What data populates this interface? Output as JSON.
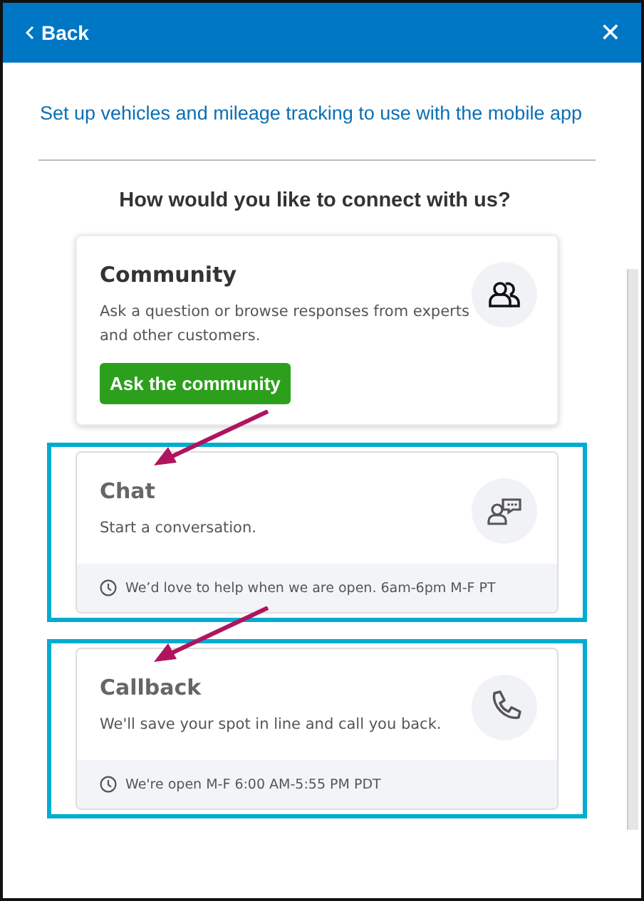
{
  "header": {
    "back_label": "Back",
    "close_label": "✕"
  },
  "link": "Set up vehicles and mileage tracking to use with the mobile app",
  "heading": "How would you like to connect with us?",
  "cards": [
    {
      "kind": "community",
      "title": "Community",
      "description": "Ask a question or browse responses from experts and other customers.",
      "button": "Ask the community",
      "highlighted": false
    },
    {
      "kind": "chat",
      "title": "Chat",
      "description": "Start a conversation.",
      "hours": "We’d love to help when we are open. 6am-6pm M-F PT",
      "highlighted": true
    },
    {
      "kind": "callback",
      "title": "Callback",
      "description": "We'll save your spot in line and call you back.",
      "hours": "We're open M-F 6:00 AM-5:55 PM PDT",
      "highlighted": true
    }
  ]
}
